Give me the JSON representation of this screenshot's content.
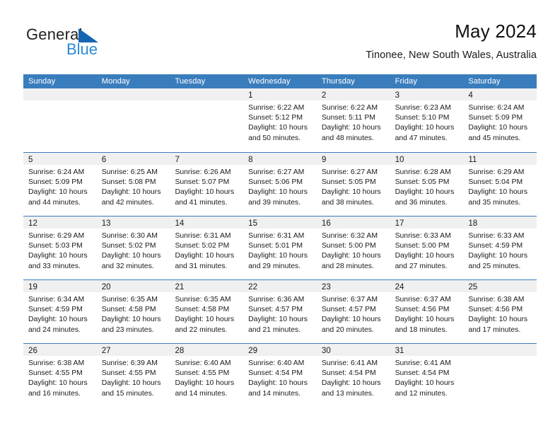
{
  "brand": {
    "word_one": "General",
    "word_two": "Blue",
    "triangle_color": "#1565b0",
    "blue_text_color": "#2b8ad4"
  },
  "header": {
    "title": "May 2024",
    "subtitle": "Tinonee, New South Wales, Australia"
  },
  "theme": {
    "header_bg": "#3a7dbd",
    "header_text": "#ffffff",
    "daynum_band": "#f0f0f0",
    "text": "#1a1a1a"
  },
  "weekday_headers": [
    "Sunday",
    "Monday",
    "Tuesday",
    "Wednesday",
    "Thursday",
    "Friday",
    "Saturday"
  ],
  "weeks": [
    [
      {
        "day": "",
        "lines": []
      },
      {
        "day": "",
        "lines": []
      },
      {
        "day": "",
        "lines": []
      },
      {
        "day": "1",
        "lines": [
          "Sunrise: 6:22 AM",
          "Sunset: 5:12 PM",
          "Daylight: 10 hours",
          "and 50 minutes."
        ]
      },
      {
        "day": "2",
        "lines": [
          "Sunrise: 6:22 AM",
          "Sunset: 5:11 PM",
          "Daylight: 10 hours",
          "and 48 minutes."
        ]
      },
      {
        "day": "3",
        "lines": [
          "Sunrise: 6:23 AM",
          "Sunset: 5:10 PM",
          "Daylight: 10 hours",
          "and 47 minutes."
        ]
      },
      {
        "day": "4",
        "lines": [
          "Sunrise: 6:24 AM",
          "Sunset: 5:09 PM",
          "Daylight: 10 hours",
          "and 45 minutes."
        ]
      }
    ],
    [
      {
        "day": "5",
        "lines": [
          "Sunrise: 6:24 AM",
          "Sunset: 5:09 PM",
          "Daylight: 10 hours",
          "and 44 minutes."
        ]
      },
      {
        "day": "6",
        "lines": [
          "Sunrise: 6:25 AM",
          "Sunset: 5:08 PM",
          "Daylight: 10 hours",
          "and 42 minutes."
        ]
      },
      {
        "day": "7",
        "lines": [
          "Sunrise: 6:26 AM",
          "Sunset: 5:07 PM",
          "Daylight: 10 hours",
          "and 41 minutes."
        ]
      },
      {
        "day": "8",
        "lines": [
          "Sunrise: 6:27 AM",
          "Sunset: 5:06 PM",
          "Daylight: 10 hours",
          "and 39 minutes."
        ]
      },
      {
        "day": "9",
        "lines": [
          "Sunrise: 6:27 AM",
          "Sunset: 5:05 PM",
          "Daylight: 10 hours",
          "and 38 minutes."
        ]
      },
      {
        "day": "10",
        "lines": [
          "Sunrise: 6:28 AM",
          "Sunset: 5:05 PM",
          "Daylight: 10 hours",
          "and 36 minutes."
        ]
      },
      {
        "day": "11",
        "lines": [
          "Sunrise: 6:29 AM",
          "Sunset: 5:04 PM",
          "Daylight: 10 hours",
          "and 35 minutes."
        ]
      }
    ],
    [
      {
        "day": "12",
        "lines": [
          "Sunrise: 6:29 AM",
          "Sunset: 5:03 PM",
          "Daylight: 10 hours",
          "and 33 minutes."
        ]
      },
      {
        "day": "13",
        "lines": [
          "Sunrise: 6:30 AM",
          "Sunset: 5:02 PM",
          "Daylight: 10 hours",
          "and 32 minutes."
        ]
      },
      {
        "day": "14",
        "lines": [
          "Sunrise: 6:31 AM",
          "Sunset: 5:02 PM",
          "Daylight: 10 hours",
          "and 31 minutes."
        ]
      },
      {
        "day": "15",
        "lines": [
          "Sunrise: 6:31 AM",
          "Sunset: 5:01 PM",
          "Daylight: 10 hours",
          "and 29 minutes."
        ]
      },
      {
        "day": "16",
        "lines": [
          "Sunrise: 6:32 AM",
          "Sunset: 5:00 PM",
          "Daylight: 10 hours",
          "and 28 minutes."
        ]
      },
      {
        "day": "17",
        "lines": [
          "Sunrise: 6:33 AM",
          "Sunset: 5:00 PM",
          "Daylight: 10 hours",
          "and 27 minutes."
        ]
      },
      {
        "day": "18",
        "lines": [
          "Sunrise: 6:33 AM",
          "Sunset: 4:59 PM",
          "Daylight: 10 hours",
          "and 25 minutes."
        ]
      }
    ],
    [
      {
        "day": "19",
        "lines": [
          "Sunrise: 6:34 AM",
          "Sunset: 4:59 PM",
          "Daylight: 10 hours",
          "and 24 minutes."
        ]
      },
      {
        "day": "20",
        "lines": [
          "Sunrise: 6:35 AM",
          "Sunset: 4:58 PM",
          "Daylight: 10 hours",
          "and 23 minutes."
        ]
      },
      {
        "day": "21",
        "lines": [
          "Sunrise: 6:35 AM",
          "Sunset: 4:58 PM",
          "Daylight: 10 hours",
          "and 22 minutes."
        ]
      },
      {
        "day": "22",
        "lines": [
          "Sunrise: 6:36 AM",
          "Sunset: 4:57 PM",
          "Daylight: 10 hours",
          "and 21 minutes."
        ]
      },
      {
        "day": "23",
        "lines": [
          "Sunrise: 6:37 AM",
          "Sunset: 4:57 PM",
          "Daylight: 10 hours",
          "and 20 minutes."
        ]
      },
      {
        "day": "24",
        "lines": [
          "Sunrise: 6:37 AM",
          "Sunset: 4:56 PM",
          "Daylight: 10 hours",
          "and 18 minutes."
        ]
      },
      {
        "day": "25",
        "lines": [
          "Sunrise: 6:38 AM",
          "Sunset: 4:56 PM",
          "Daylight: 10 hours",
          "and 17 minutes."
        ]
      }
    ],
    [
      {
        "day": "26",
        "lines": [
          "Sunrise: 6:38 AM",
          "Sunset: 4:55 PM",
          "Daylight: 10 hours",
          "and 16 minutes."
        ]
      },
      {
        "day": "27",
        "lines": [
          "Sunrise: 6:39 AM",
          "Sunset: 4:55 PM",
          "Daylight: 10 hours",
          "and 15 minutes."
        ]
      },
      {
        "day": "28",
        "lines": [
          "Sunrise: 6:40 AM",
          "Sunset: 4:55 PM",
          "Daylight: 10 hours",
          "and 14 minutes."
        ]
      },
      {
        "day": "29",
        "lines": [
          "Sunrise: 6:40 AM",
          "Sunset: 4:54 PM",
          "Daylight: 10 hours",
          "and 14 minutes."
        ]
      },
      {
        "day": "30",
        "lines": [
          "Sunrise: 6:41 AM",
          "Sunset: 4:54 PM",
          "Daylight: 10 hours",
          "and 13 minutes."
        ]
      },
      {
        "day": "31",
        "lines": [
          "Sunrise: 6:41 AM",
          "Sunset: 4:54 PM",
          "Daylight: 10 hours",
          "and 12 minutes."
        ]
      },
      {
        "day": "",
        "lines": []
      }
    ]
  ]
}
